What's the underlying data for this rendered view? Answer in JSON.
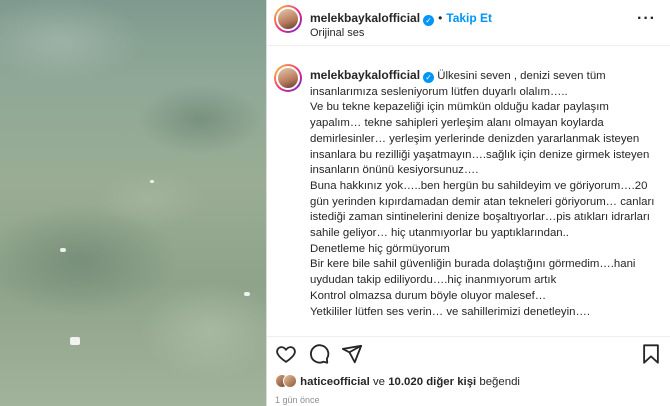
{
  "header": {
    "username": "melekbaykalofficial",
    "verified_icon": "verified-badge-icon",
    "separator": "•",
    "follow_label": "Takip Et",
    "audio_label": "Orijinal ses",
    "more_icon": "more-options-icon"
  },
  "caption": {
    "username": "melekbaykalofficial",
    "first_line": "Ülkesini seven , denizi seven tüm insanlarımıza sesleniyorum lütfen duyarlı olalım…..",
    "lines": [
      "Ve bu tekne kepazeliği için mümkün olduğu kadar paylaşım yapalım… tekne sahipleri yerleşim alanı olmayan koylarda demirlesinler… yerleşim yerlerinde denizden yararlanmak isteyen insanlara bu rezilliği yaşatmayın….sağlık için denize girmek isteyen insanların önünü kesiyorsunuz….",
      "Buna hakkınız yok…..ben hergün bu sahildeyim ve göriyorum….20 gün yerinden kıpırdamadan demir atan tekneleri göriyorum… canları istediği zaman sintinelerini denize boşaltıyorlar…pis atıkları idrarları sahile geliyor… hiç utanmıyorlar bu yaptıklarından..",
      "Denetleme hiç görmüyorum",
      "Bir kere bile sahil güvenliğin burada dolaştığını görmedim….hani uydudan takip ediliyordu….hiç inanmıyorum artık",
      "Kontrol olmazsa durum böyle oluyor malesef…",
      "Yetkililer lütfen ses verin… ve sahillerimizi denetleyin…."
    ]
  },
  "actions": {
    "like_icon": "heart-icon",
    "comment_icon": "comment-icon",
    "share_icon": "share-icon",
    "save_icon": "bookmark-icon"
  },
  "likes": {
    "liker": "haticeofficial",
    "connector": "ve",
    "count": "10.020 diğer kişi",
    "suffix": "beğendi"
  },
  "timestamp": "1 gün önce",
  "colors": {
    "accent": "#0095f6",
    "text": "#262626",
    "muted": "#8e8e8e",
    "border": "#dbdbdb"
  }
}
